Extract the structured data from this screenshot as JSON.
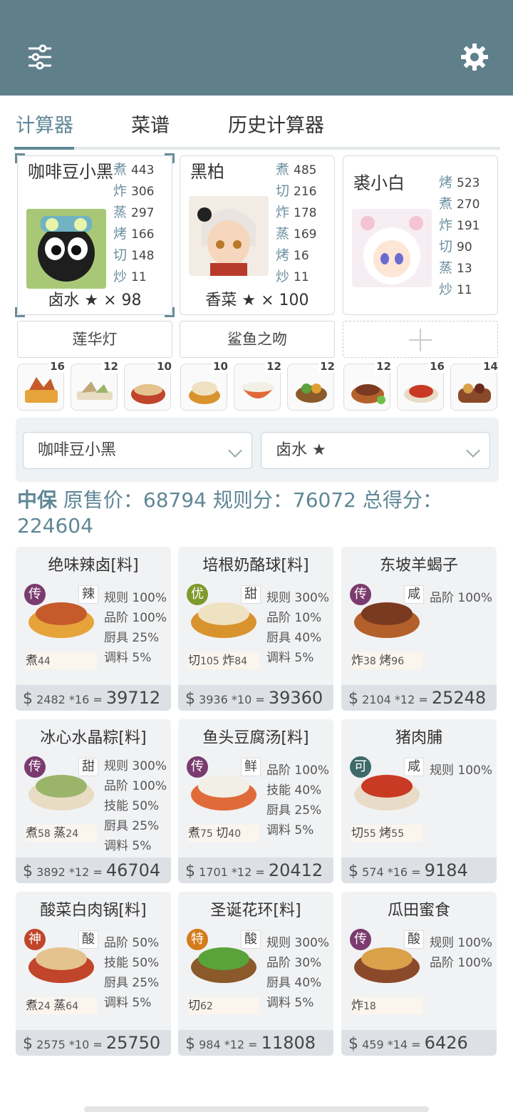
{
  "app": {
    "filter_icon": "sliders-icon",
    "settings_icon": "gear-icon"
  },
  "tabs": [
    {
      "label": "计算器"
    },
    {
      "label": "菜谱"
    },
    {
      "label": "历史计算器"
    }
  ],
  "chefs": [
    {
      "name": "咖啡豆小黑",
      "equip": "卤水 ★ × 98",
      "stats": [
        {
          "k": "煮",
          "v": "443"
        },
        {
          "k": "炸",
          "v": "306"
        },
        {
          "k": "蒸",
          "v": "297"
        },
        {
          "k": "烤",
          "v": "166"
        },
        {
          "k": "切",
          "v": "148"
        },
        {
          "k": "炒",
          "v": "11"
        }
      ]
    },
    {
      "name": "黑柏",
      "equip": "香菜 ★ × 100",
      "stats": [
        {
          "k": "煮",
          "v": "485"
        },
        {
          "k": "切",
          "v": "216"
        },
        {
          "k": "炸",
          "v": "178"
        },
        {
          "k": "蒸",
          "v": "169"
        },
        {
          "k": "烤",
          "v": "16"
        },
        {
          "k": "炒",
          "v": "11"
        }
      ]
    },
    {
      "name": "裘小白",
      "equip": "",
      "stats": [
        {
          "k": "烤",
          "v": "523"
        },
        {
          "k": "煮",
          "v": "270"
        },
        {
          "k": "炸",
          "v": "191"
        },
        {
          "k": "切",
          "v": "90"
        },
        {
          "k": "蒸",
          "v": "13"
        },
        {
          "k": "炒",
          "v": "11"
        }
      ]
    }
  ],
  "tools": [
    "莲华灯",
    "鲨鱼之吻",
    ""
  ],
  "thumb_counts": [
    "16",
    "12",
    "10",
    "10",
    "12",
    "12",
    "12",
    "16",
    "14"
  ],
  "selectors": {
    "chef": "咖啡豆小黑",
    "condiment": "卤水 ★"
  },
  "summary": {
    "prefix": "中保",
    "text": " 原售价：68794 规则分：76072 总得分：",
    "total": "224604"
  },
  "recipes": [
    {
      "title": "绝味辣卤[料]",
      "rarity": "传",
      "flavor": "辣",
      "bonus": [
        "规则 100%",
        "品阶 100%",
        "厨具 25%",
        "调料 5%"
      ],
      "skills": [
        {
          "k": "煮",
          "v": "44"
        }
      ],
      "price": "2482",
      "mult": "*16",
      "total": "39712"
    },
    {
      "title": "培根奶酪球[料]",
      "rarity": "优",
      "flavor": "甜",
      "bonus": [
        "规则 300%",
        "品阶 10%",
        "厨具 40%",
        "调料 5%"
      ],
      "skills": [
        {
          "k": "切",
          "v": "105"
        },
        {
          "k": "炸",
          "v": "84"
        }
      ],
      "price": "3936",
      "mult": "*10",
      "total": "39360"
    },
    {
      "title": "东坡羊蝎子",
      "rarity": "传",
      "flavor": "咸",
      "bonus": [
        "品阶 100%"
      ],
      "skills": [
        {
          "k": "炸",
          "v": "38"
        },
        {
          "k": "烤",
          "v": "96"
        }
      ],
      "price": "2104",
      "mult": "*12",
      "total": "25248"
    },
    {
      "title": "冰心水晶粽[料]",
      "rarity": "传",
      "flavor": "甜",
      "bonus": [
        "规则 300%",
        "品阶 100%",
        "技能 50%",
        "厨具 25%",
        "调料 5%"
      ],
      "skills": [
        {
          "k": "煮",
          "v": "58"
        },
        {
          "k": "蒸",
          "v": "24"
        }
      ],
      "price": "3892",
      "mult": "*12",
      "total": "46704"
    },
    {
      "title": "鱼头豆腐汤[料]",
      "rarity": "传",
      "flavor": "鲜",
      "bonus": [
        "品阶 100%",
        "技能 40%",
        "厨具 25%",
        "调料 5%"
      ],
      "skills": [
        {
          "k": "煮",
          "v": "75"
        },
        {
          "k": "切",
          "v": "40"
        }
      ],
      "price": "1701",
      "mult": "*12",
      "total": "20412"
    },
    {
      "title": "猪肉脯",
      "rarity": "可",
      "flavor": "咸",
      "bonus": [
        "规则 100%"
      ],
      "skills": [
        {
          "k": "切",
          "v": "55"
        },
        {
          "k": "烤",
          "v": "55"
        }
      ],
      "price": "574",
      "mult": "*16",
      "total": "9184"
    },
    {
      "title": "酸菜白肉锅[料]",
      "rarity": "神",
      "flavor": "酸",
      "bonus": [
        "品阶 50%",
        "技能 50%",
        "厨具 25%",
        "调料 5%"
      ],
      "skills": [
        {
          "k": "煮",
          "v": "24"
        },
        {
          "k": "蒸",
          "v": "64"
        }
      ],
      "price": "2575",
      "mult": "*10",
      "total": "25750"
    },
    {
      "title": "圣诞花环[料]",
      "rarity": "特",
      "flavor": "酸",
      "bonus": [
        "规则 300%",
        "品阶 30%",
        "厨具 40%",
        "调料 5%"
      ],
      "skills": [
        {
          "k": "切",
          "v": "62"
        }
      ],
      "price": "984",
      "mult": "*12",
      "total": "11808"
    },
    {
      "title": "瓜田蜜食",
      "rarity": "传",
      "flavor": "酸",
      "bonus": [
        "规则 100%",
        "品阶 100%"
      ],
      "skills": [
        {
          "k": "炸",
          "v": "18"
        }
      ],
      "price": "459",
      "mult": "*14",
      "total": "6426"
    }
  ],
  "colors": {
    "header": "#5f7f8b",
    "accent": "#5f8796",
    "rar_legend": "#7a3b6e",
    "rar_good": "#7e9a2c",
    "rar_common": "#3e6a6a",
    "rar_god": "#c0452a",
    "rar_special": "#d47b1c"
  }
}
